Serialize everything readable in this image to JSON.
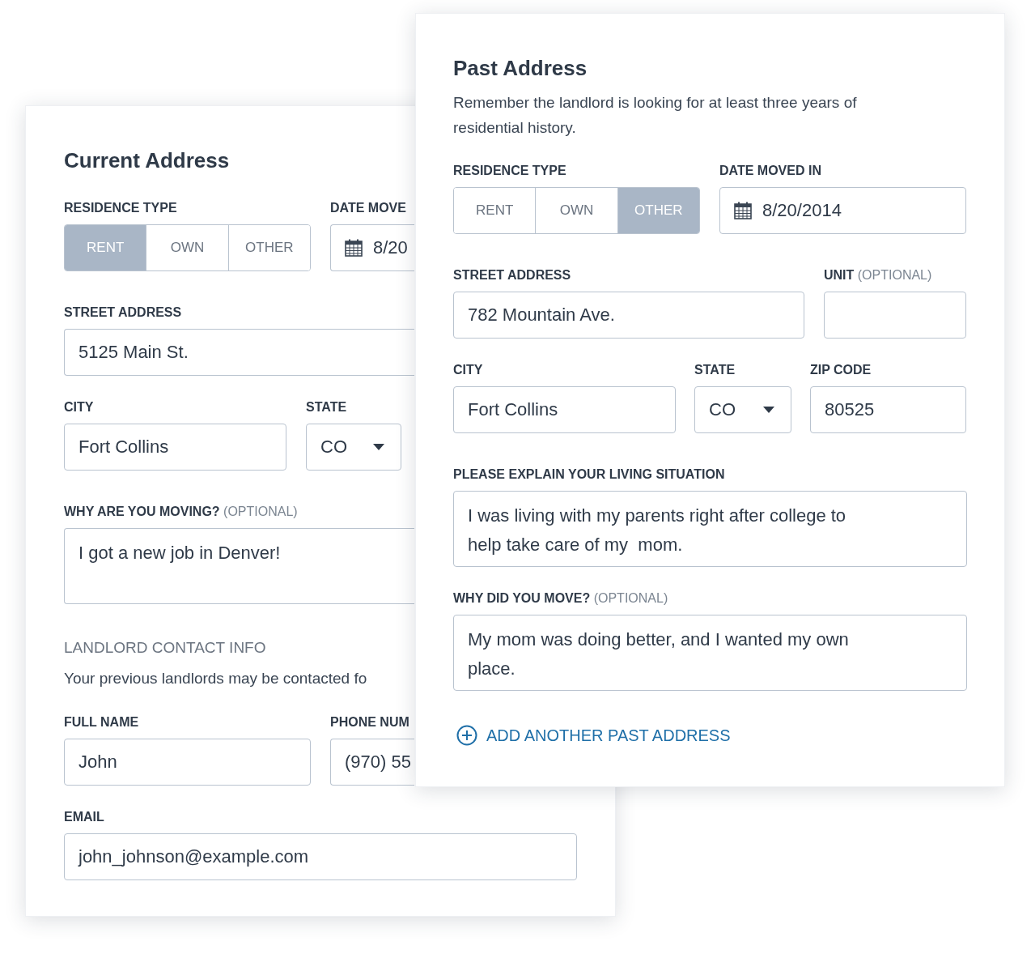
{
  "current_address": {
    "title": "Current Address",
    "residence_type": {
      "label": "RESIDENCE TYPE",
      "options": [
        {
          "label": "RENT",
          "selected": true
        },
        {
          "label": "OWN",
          "selected": false
        },
        {
          "label": "OTHER",
          "selected": false
        }
      ]
    },
    "date_moved_in": {
      "label": "DATE MOVE",
      "value": "8/20"
    },
    "street_address": {
      "label": "STREET ADDRESS",
      "value": "5125 Main St."
    },
    "city": {
      "label": "CITY",
      "value": "Fort Collins"
    },
    "state": {
      "label": "STATE",
      "value": "CO"
    },
    "reason": {
      "label": "WHY ARE YOU MOVING?",
      "optional": "(OPTIONAL)",
      "value": "I got a new job in Denver!"
    },
    "landlord_contact": {
      "heading": "LANDLORD CONTACT INFO",
      "note": "Your previous landlords may be contacted fo"
    },
    "full_name": {
      "label": "FULL NAME",
      "value": "John"
    },
    "phone_number": {
      "label": "PHONE NUM",
      "value": "(970) 55"
    },
    "email": {
      "label": "EMAIL",
      "value": "john_johnson@example.com"
    }
  },
  "past_address": {
    "title": "Past Address",
    "description": "Remember the landlord is looking for at least three years of residential history.",
    "residence_type": {
      "label": "RESIDENCE TYPE",
      "options": [
        {
          "label": "RENT",
          "selected": false
        },
        {
          "label": "OWN",
          "selected": false
        },
        {
          "label": "OTHER",
          "selected": true
        }
      ]
    },
    "date_moved_in": {
      "label": "DATE MOVED IN",
      "value": "8/20/2014"
    },
    "street_address": {
      "label": "STREET ADDRESS",
      "value": "782 Mountain Ave."
    },
    "unit": {
      "label": "UNIT",
      "optional": "(OPTIONAL)"
    },
    "city": {
      "label": "CITY",
      "value": "Fort Collins"
    },
    "state": {
      "label": "STATE",
      "value": "CO"
    },
    "zip_code": {
      "label": "ZIP CODE",
      "value": "80525"
    },
    "living_situation": {
      "label": "PLEASE EXPLAIN YOUR LIVING SITUATION",
      "value": "I was living with my parents right after college to help take care of my  mom."
    },
    "reason": {
      "label": "WHY DID YOU MOVE?",
      "optional": "(OPTIONAL)",
      "value": "My mom was doing better, and I wanted my own place."
    },
    "add_link": "ADD ANOTHER PAST ADDRESS"
  }
}
